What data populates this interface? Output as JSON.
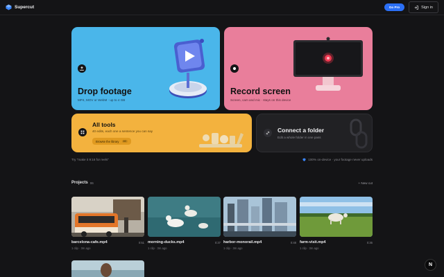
{
  "app": {
    "name": "Supercut"
  },
  "header": {
    "pro_label": "Go Pro",
    "signin_label": "Sign in"
  },
  "cards": {
    "drop": {
      "title": "Drop footage",
      "subtitle": "MP4, MOV or WebM · up to 4 GB"
    },
    "record": {
      "title": "Record screen",
      "subtitle": "Screen, cam and mic · stays on this device"
    },
    "tools": {
      "title": "All tools",
      "subtitle": "40 edits, each one a sentence you can say",
      "browse_label": "Browse the library",
      "browse_count": "40"
    },
    "folder": {
      "title": "Connect a folder",
      "subtitle": "Edit a whole folder in one pass"
    }
  },
  "hints": {
    "left": "Try \"make it 9:16 for reels\"",
    "right": "100% on-device · your footage never uploads"
  },
  "projects": {
    "title": "Projects",
    "count": "06",
    "new_label": "New cut",
    "items": [
      {
        "name": "barcelona-cafe.mp4",
        "duration": "0:51",
        "meta": "1 clip · 3m ago"
      },
      {
        "name": "morning-ducks.mp4",
        "duration": "0:37",
        "meta": "1 clip · 3m ago"
      },
      {
        "name": "harbor-monorail.mp4",
        "duration": "0:48",
        "meta": "1 clip · 3m ago"
      },
      {
        "name": "farm-visit.mp4",
        "duration": "0:36",
        "meta": "1 clip · 3m ago"
      }
    ]
  },
  "badge": {
    "letter": "N"
  },
  "colors": {
    "accent": "#2b6ff5",
    "drop_card": "#4ab6ea",
    "record_card": "#e97e9b",
    "tools_card": "#f3b23e",
    "background": "#141416"
  }
}
